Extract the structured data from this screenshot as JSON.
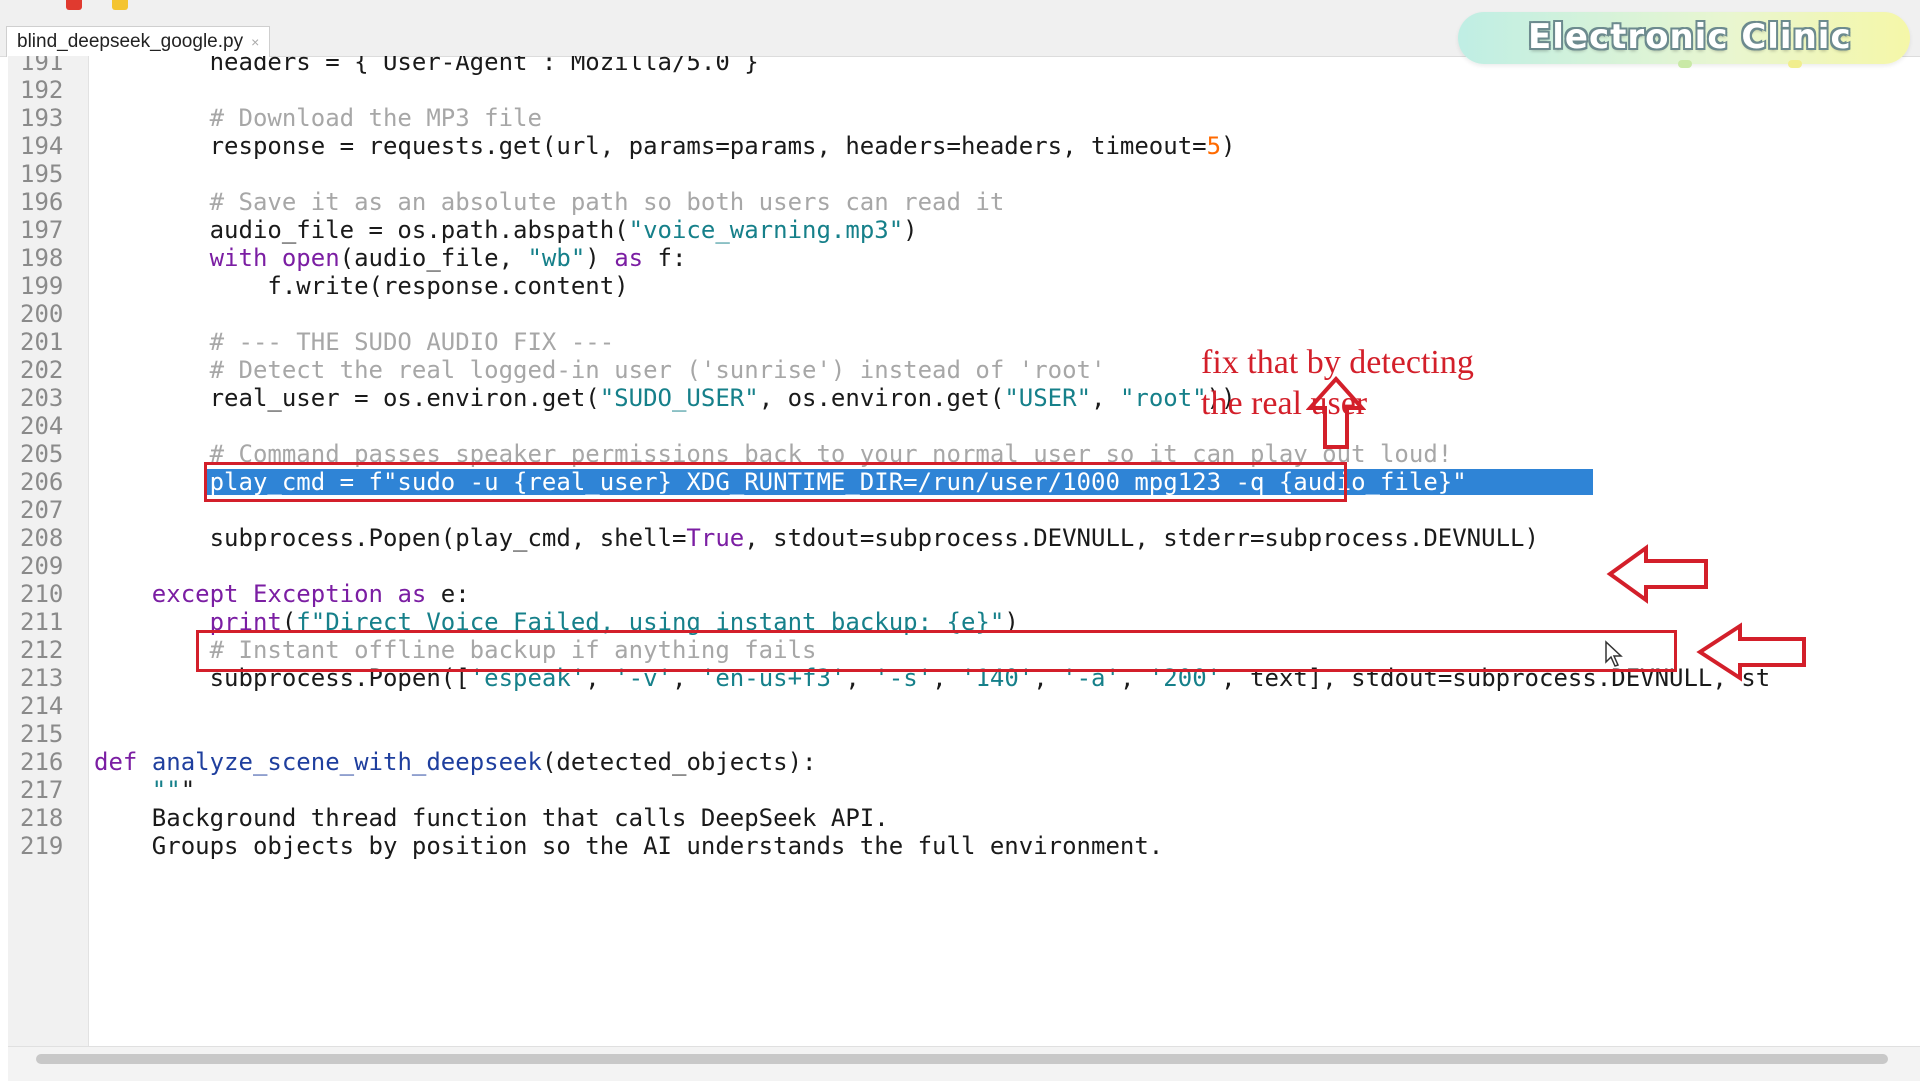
{
  "tab": {
    "filename": "blind_deepseek_google.py",
    "close_glyph": "×"
  },
  "logo": {
    "text": "Electronic Clinic"
  },
  "annotation": {
    "line1": "fix that by detecting",
    "line2": "the real user"
  },
  "colors": {
    "accent_red": "#d31f2a",
    "selection_blue": "#2f84d6",
    "keyword": "#7b1ea3",
    "string": "#16808a"
  },
  "lines": [
    {
      "n": "191",
      "t": "        headers = { User-Agent : Mozilla/5.0 }"
    },
    {
      "n": "192",
      "t": ""
    },
    {
      "n": "193",
      "t": "        # Download the MP3 file"
    },
    {
      "n": "194",
      "t": "        response = requests.get(url, params=params, headers=headers, timeout=5)"
    },
    {
      "n": "195",
      "t": ""
    },
    {
      "n": "196",
      "t": "        # Save it as an absolute path so both users can read it"
    },
    {
      "n": "197",
      "t": "        audio_file = os.path.abspath(\"voice_warning.mp3\")"
    },
    {
      "n": "198",
      "t": "        with open(audio_file, \"wb\") as f:"
    },
    {
      "n": "199",
      "t": "            f.write(response.content)"
    },
    {
      "n": "200",
      "t": ""
    },
    {
      "n": "201",
      "t": "        # --- THE SUDO AUDIO FIX ---"
    },
    {
      "n": "202",
      "t": "        # Detect the real logged-in user ('sunrise') instead of 'root'"
    },
    {
      "n": "203",
      "t": "        real_user = os.environ.get(\"SUDO_USER\", os.environ.get(\"USER\", \"root\"))"
    },
    {
      "n": "204",
      "t": ""
    },
    {
      "n": "205",
      "t": "        # Command passes speaker permissions back to your normal user so it can play out loud!"
    },
    {
      "n": "206",
      "t": "        play_cmd = f\"sudo -u {real_user} XDG_RUNTIME_DIR=/run/user/1000 mpg123 -q {audio_file}\""
    },
    {
      "n": "207",
      "t": ""
    },
    {
      "n": "208",
      "t": "        subprocess.Popen(play_cmd, shell=True, stdout=subprocess.DEVNULL, stderr=subprocess.DEVNULL)"
    },
    {
      "n": "209",
      "t": ""
    },
    {
      "n": "210",
      "t": "    except Exception as e:"
    },
    {
      "n": "211",
      "t": "        print(f\"Direct Voice Failed, using instant backup: {e}\")"
    },
    {
      "n": "212",
      "t": "        # Instant offline backup if anything fails"
    },
    {
      "n": "213",
      "t": "        subprocess.Popen(['espeak', '-v', 'en-us+f3', '-s', '140', '-a', '200', text], stdout=subprocess.DEVNULL, st"
    },
    {
      "n": "214",
      "t": ""
    },
    {
      "n": "215",
      "t": ""
    },
    {
      "n": "216",
      "t": "def analyze_scene_with_deepseek(detected_objects):"
    },
    {
      "n": "217",
      "t": "    \"\"\""
    },
    {
      "n": "218",
      "t": "    Background thread function that calls DeepSeek API."
    },
    {
      "n": "219",
      "t": "    Groups objects by position so the AI understands the full environment."
    }
  ]
}
